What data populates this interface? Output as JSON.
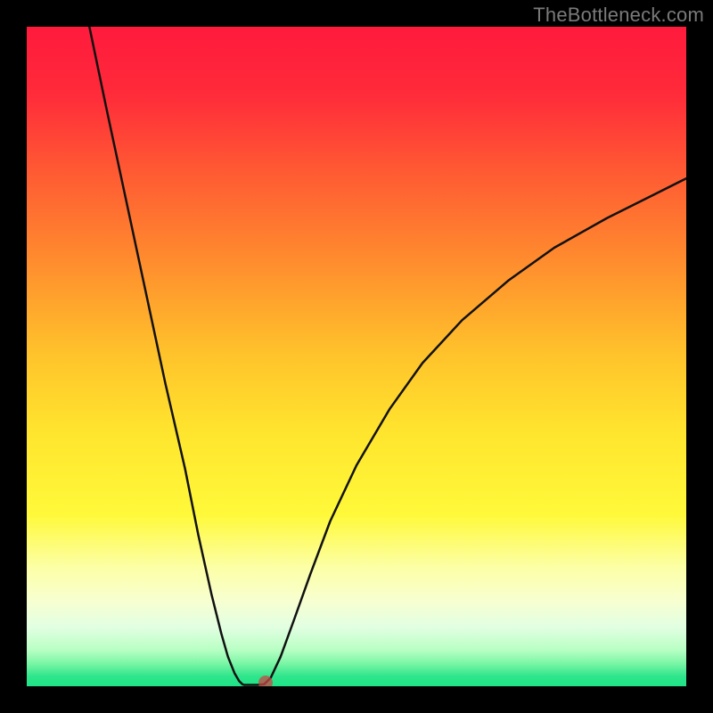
{
  "watermark": "TheBottleneck.com",
  "chart_data": {
    "type": "line",
    "title": "",
    "xlabel": "",
    "ylabel": "",
    "xlim": [
      0,
      100
    ],
    "ylim": [
      0,
      100
    ],
    "axes_visible": false,
    "grid": false,
    "background_gradient": {
      "stops": [
        {
          "pos": 0.0,
          "color": "#ff1a3c"
        },
        {
          "pos": 0.1,
          "color": "#ff2a3a"
        },
        {
          "pos": 0.22,
          "color": "#ff5a33"
        },
        {
          "pos": 0.35,
          "color": "#ff8a2e"
        },
        {
          "pos": 0.5,
          "color": "#ffc42b"
        },
        {
          "pos": 0.62,
          "color": "#ffe62e"
        },
        {
          "pos": 0.74,
          "color": "#fff93a"
        },
        {
          "pos": 0.82,
          "color": "#fcffa6"
        },
        {
          "pos": 0.87,
          "color": "#f8ffd0"
        },
        {
          "pos": 0.91,
          "color": "#e2ffe2"
        },
        {
          "pos": 0.945,
          "color": "#b8ffc4"
        },
        {
          "pos": 0.965,
          "color": "#7cf6a6"
        },
        {
          "pos": 0.985,
          "color": "#2fe58b"
        },
        {
          "pos": 1.0,
          "color": "#1ee487"
        }
      ]
    },
    "series": [
      {
        "name": "bottleneck-left",
        "x": [
          9.5,
          12,
          15,
          18,
          21,
          24,
          26,
          28,
          29.5,
          30.5,
          31.5,
          32.2,
          32.7,
          33
        ],
        "values": [
          100,
          88,
          74,
          60,
          46,
          33,
          23,
          14,
          8,
          4.5,
          2.0,
          0.8,
          0.3,
          0.2
        ]
      },
      {
        "name": "bottleneck-flat",
        "x": [
          33,
          34,
          35,
          36
        ],
        "values": [
          0.2,
          0.2,
          0.2,
          0.3
        ]
      },
      {
        "name": "bottleneck-right",
        "x": [
          36,
          37,
          38.5,
          40.5,
          43,
          46,
          50,
          55,
          60,
          66,
          73,
          80,
          88,
          95,
          100
        ],
        "values": [
          0.3,
          1.3,
          4.5,
          10,
          17,
          25,
          33.5,
          42,
          49,
          55.5,
          61.5,
          66.5,
          71,
          74.5,
          77
        ]
      }
    ],
    "marker": {
      "x": 36.2,
      "y": 0.5,
      "color": "#c84646"
    }
  }
}
